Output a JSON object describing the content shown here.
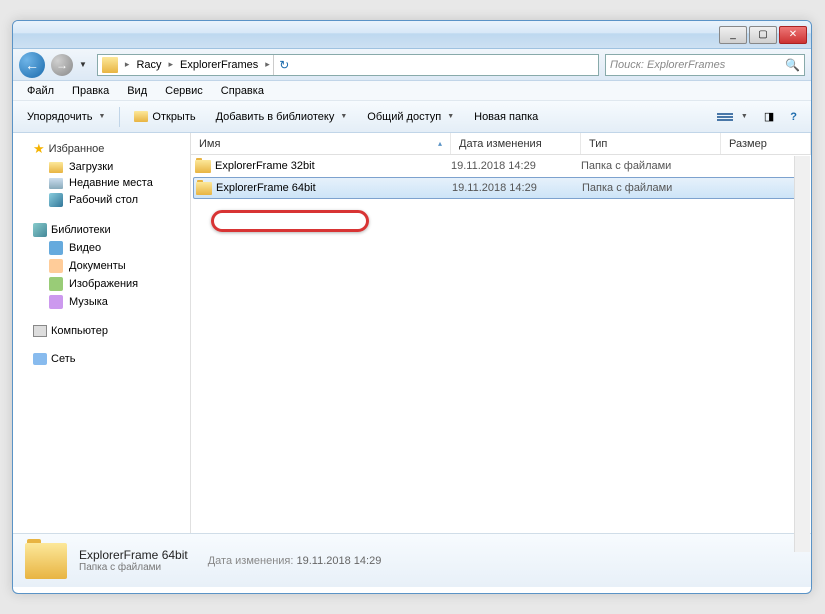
{
  "window": {
    "min": "_",
    "max": "▢",
    "close": "✕"
  },
  "address": {
    "seg1": "Racy",
    "seg2": "ExplorerFrames"
  },
  "search": {
    "placeholder": "Поиск: ExplorerFrames"
  },
  "menu": {
    "file": "Файл",
    "edit": "Правка",
    "view": "Вид",
    "tools": "Сервис",
    "help": "Справка"
  },
  "toolbar": {
    "organize": "Упорядочить",
    "open": "Открыть",
    "library": "Добавить в библиотеку",
    "share": "Общий доступ",
    "newfolder": "Новая папка"
  },
  "sidebar": {
    "favorites": "Избранное",
    "downloads": "Загрузки",
    "recent": "Недавние места",
    "desktop": "Рабочий стол",
    "libraries": "Библиотеки",
    "video": "Видео",
    "documents": "Документы",
    "pictures": "Изображения",
    "music": "Музыка",
    "computer": "Компьютер",
    "network": "Сеть"
  },
  "columns": {
    "name": "Имя",
    "date": "Дата изменения",
    "type": "Тип",
    "size": "Размер"
  },
  "files": [
    {
      "name": "ExplorerFrame 32bit",
      "date": "19.11.2018 14:29",
      "type": "Папка с файлами"
    },
    {
      "name": "ExplorerFrame 64bit",
      "date": "19.11.2018 14:29",
      "type": "Папка с файлами"
    }
  ],
  "details": {
    "name": "ExplorerFrame 64bit",
    "type": "Папка с файлами",
    "date_label": "Дата изменения:",
    "date": "19.11.2018 14:29"
  }
}
